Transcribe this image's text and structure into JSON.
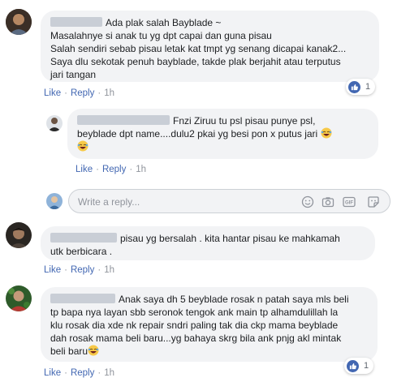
{
  "comments": [
    {
      "author": "Ada plak salah Bayblade ~",
      "lines": [
        "Masalahnye si anak tu yg dpt capai dan guna pisau",
        "Salah sendiri sebab pisau letak kat tmpt yg senang dicapai kanak2...",
        "Saya dlu sekotak penuh bayblade, takde plak berjahit atau terputus",
        "jari tangan"
      ],
      "like": "Like",
      "reply": "Reply",
      "time": "1h",
      "reaction_count": "1"
    },
    {
      "lines_first": "Fnzi Ziruu tu psl pisau punye psl,",
      "lines": [
        "beyblade dpt name....dulu2 pkai yg besi pon x putus jari"
      ],
      "like": "Like",
      "reply": "Reply",
      "time": "1h"
    },
    {
      "lines_first": "pisau yg bersalah . kita hantar pisau ke mahkamah",
      "lines": [
        "utk berbicara ."
      ],
      "like": "Like",
      "reply": "Reply",
      "time": "1h"
    },
    {
      "lines_first": "Anak saya dh 5 beyblade rosak n patah saya mls beli",
      "lines": [
        "tp bapa nya layan sbb seronok tengok ank main tp alhamdulillah la",
        "klu rosak dia xde nk repair sndri paling tak dia ckp mama beyblade",
        "dah rosak mama beli baru...yg bahaya skrg bila ank pnjg akl mintak",
        "beli baru"
      ],
      "like": "Like",
      "reply": "Reply",
      "time": "1h",
      "reaction_count": "1"
    }
  ],
  "reply_box": {
    "placeholder": "Write a reply..."
  },
  "icons": [
    "like-icon",
    "emoji-icon",
    "camera-icon",
    "gif-icon",
    "sticker-icon",
    "laughing-emoji-icon"
  ],
  "colors": {
    "link": "#4267b2",
    "bubble": "#f2f3f5",
    "muted": "#90949c"
  }
}
